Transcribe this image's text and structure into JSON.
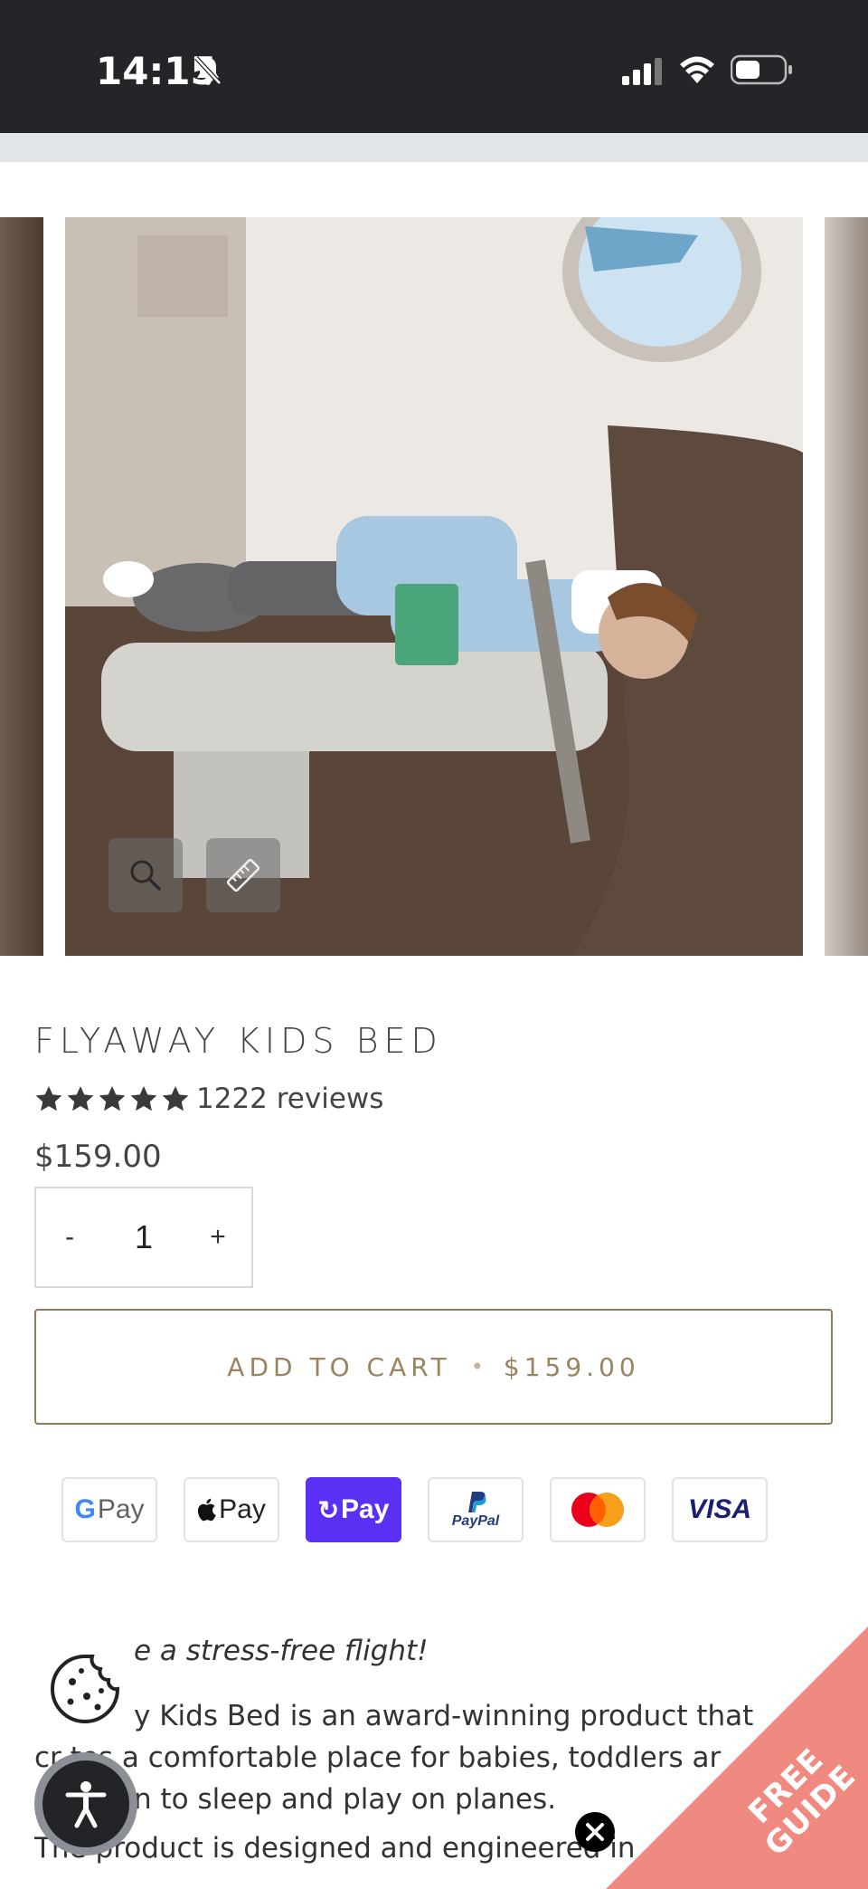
{
  "status_bar": {
    "time": "14:15"
  },
  "product": {
    "title": "FLYAWAY KIDS BED",
    "rating_stars": 5,
    "reviews": "1222 reviews",
    "price": "$159.00",
    "quantity": "1",
    "qty_minus": "-",
    "qty_plus": "+"
  },
  "cart": {
    "label": "ADD TO CART",
    "separator": "•",
    "price": "$159.00"
  },
  "payments": [
    {
      "name": "Google Pay",
      "label": "G Pay"
    },
    {
      "name": "Apple Pay",
      "label": "Pay"
    },
    {
      "name": "Shop Pay",
      "label": "Pay"
    },
    {
      "name": "PayPal",
      "label": "PayPal"
    },
    {
      "name": "Mastercard",
      "label": ""
    },
    {
      "name": "Visa",
      "label": "VISA"
    }
  ],
  "description": {
    "heading": "e a stress-free flight!",
    "line1": "y Kids Bed is an award-winning product that",
    "line2": "cr     tes a comfortable place for babies, toddlers ar",
    "line3": "n to sleep and play on planes.",
    "line4": "The product is designed and engineered in"
  },
  "promo": {
    "line1": "FREE",
    "line2": "GUIDE",
    "color": "#f08a80"
  },
  "colors": {
    "accent": "#9a845f",
    "shop_pay": "#5a31f4"
  }
}
